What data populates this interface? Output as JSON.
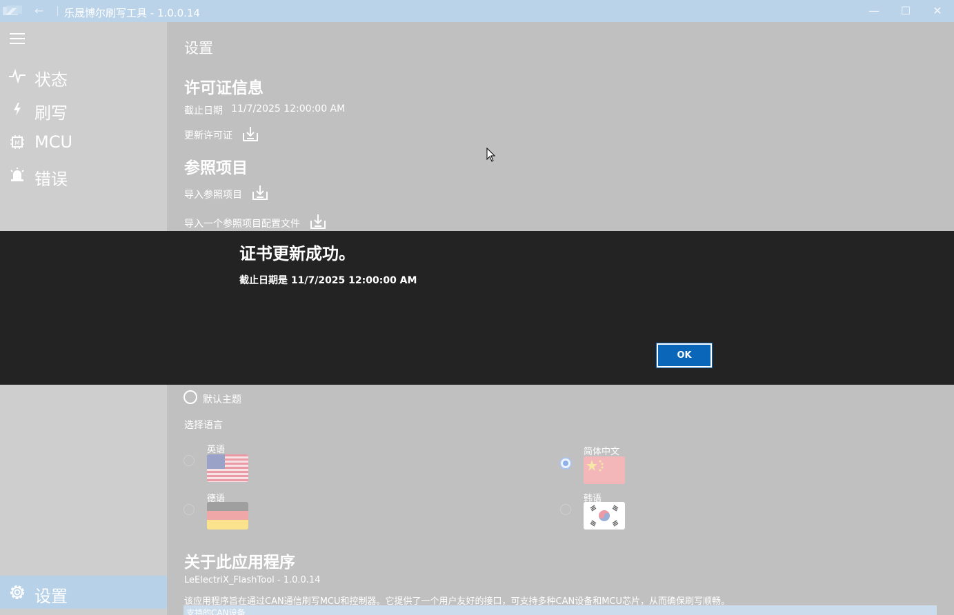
{
  "window": {
    "title": "乐晟博尔刷写工具 - 1.0.0.14",
    "back_glyph": "←",
    "minimize_glyph": "—",
    "maximize_glyph": "☐",
    "close_glyph": "✕"
  },
  "sidebar": {
    "items": [
      {
        "label": "状态",
        "icon": "pulse-icon"
      },
      {
        "label": "刷写",
        "icon": "lightning-icon"
      },
      {
        "label": "MCU",
        "icon": "chip-icon"
      },
      {
        "label": "错误",
        "icon": "alarm-icon"
      }
    ],
    "settings_label": "设置"
  },
  "main": {
    "page_title": "设置",
    "license": {
      "heading": "许可证信息",
      "expiry_label": "截止日期",
      "expiry_value": "11/7/2025 12:00:00 AM",
      "update_label": "更新许可证"
    },
    "reference": {
      "heading": "参照项目",
      "import_label": "导入参照项目",
      "import_config_label": "导入一个参照项目配置文件"
    },
    "theme": {
      "default_label": "默认主题"
    },
    "language": {
      "heading": "选择语言",
      "options": [
        {
          "label": "英语",
          "flag": "us-flag",
          "selected": false
        },
        {
          "label": "简体中文",
          "flag": "cn-flag",
          "selected": true
        },
        {
          "label": "德语",
          "flag": "de-flag",
          "selected": false
        },
        {
          "label": "韩语",
          "flag": "kr-flag",
          "selected": false
        }
      ]
    },
    "about": {
      "heading": "关于此应用程序",
      "version": "LeElectriX_FlashTool - 1.0.0.14",
      "description": "该应用程序旨在通过CAN通信刷写MCU和控制器。它提供了一个用户友好的接口，可支持多种CAN设备和MCU芯片，从而确保刷写顺畅。",
      "next_label": "支持的CAN设备"
    }
  },
  "dialog": {
    "title": "证书更新成功。",
    "message": "截止日期是 11/7/2025 12:00:00 AM",
    "ok_label": "OK"
  },
  "colors": {
    "titlebar": "#bad3e8",
    "dialog_bg": "#232323",
    "ok_button": "#0a66b9",
    "settings_highlight": "#b7d1e8"
  }
}
